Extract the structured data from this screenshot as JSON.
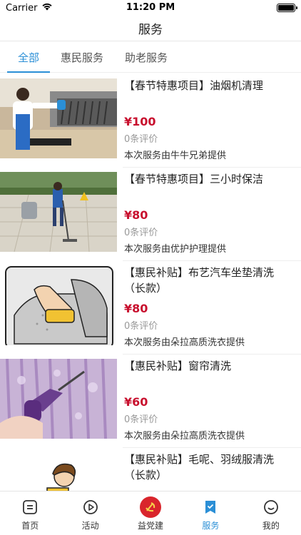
{
  "status": {
    "carrier": "Carrier",
    "time": "11:20 PM",
    "battery_level": 1.0
  },
  "nav": {
    "title": "服务"
  },
  "tabs": [
    {
      "label": "全部",
      "active": true
    },
    {
      "label": "惠民服务",
      "active": false
    },
    {
      "label": "助老服务",
      "active": false
    }
  ],
  "items": [
    {
      "title": "【春节特惠项目】油烟机清理",
      "price": "¥100",
      "reviews": "0条评价",
      "provider": "本次服务由牛牛兄弟提供"
    },
    {
      "title": "【春节特惠项目】三小时保洁",
      "price": "¥80",
      "reviews": "0条评价",
      "provider": "本次服务由优护护理提供"
    },
    {
      "title": "【惠民补贴】布艺汽车坐垫清洗（长款）",
      "price": "¥80",
      "reviews": "0条评价",
      "provider": "本次服务由朵拉高质洗衣提供"
    },
    {
      "title": "【惠民补贴】窗帘清洗",
      "price": "¥60",
      "reviews": "0条评价",
      "provider": "本次服务由朵拉高质洗衣提供"
    },
    {
      "title": "【惠民补贴】毛呢、羽绒服清洗（长款）",
      "price": "",
      "reviews": "",
      "provider": ""
    }
  ],
  "tabbar": [
    {
      "label": "首页",
      "icon": "home-icon",
      "active": false
    },
    {
      "label": "活动",
      "icon": "play-icon",
      "active": false
    },
    {
      "label": "益党建",
      "icon": "party-emblem-icon",
      "active": false
    },
    {
      "label": "服务",
      "icon": "bookmark-check-icon",
      "active": true
    },
    {
      "label": "我的",
      "icon": "smile-icon",
      "active": false
    }
  ],
  "colors": {
    "accent": "#2b8fd6",
    "price": "#c8102e",
    "party": "#d9252c"
  }
}
